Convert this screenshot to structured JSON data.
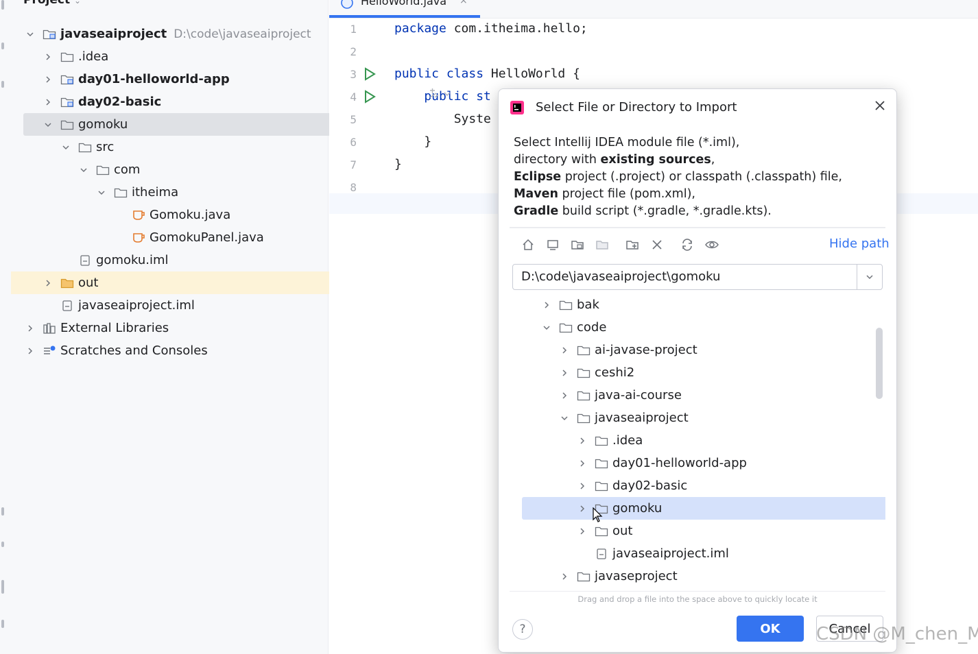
{
  "project_panel": {
    "title": "Project",
    "tree": [
      {
        "label": "javaseaiproject",
        "path": "D:\\code\\javaseaiproject",
        "bold": true,
        "indent": 0,
        "expanded": true,
        "icon": "module-folder-icon"
      },
      {
        "label": ".idea",
        "indent": 1,
        "expanded": false,
        "icon": "folder-icon"
      },
      {
        "label": "day01-helloworld-app",
        "bold": true,
        "indent": 1,
        "expanded": false,
        "icon": "module-folder-icon"
      },
      {
        "label": "day02-basic",
        "bold": true,
        "indent": 1,
        "expanded": false,
        "icon": "module-folder-icon"
      },
      {
        "label": "gomoku",
        "indent": 1,
        "expanded": true,
        "icon": "folder-icon",
        "selected": true
      },
      {
        "label": "src",
        "indent": 2,
        "expanded": true,
        "icon": "folder-icon"
      },
      {
        "label": "com",
        "indent": 3,
        "expanded": true,
        "icon": "folder-icon"
      },
      {
        "label": "itheima",
        "indent": 4,
        "expanded": true,
        "icon": "folder-icon"
      },
      {
        "label": "Gomoku.java",
        "indent": 5,
        "icon": "java-file-icon"
      },
      {
        "label": "GomokuPanel.java",
        "indent": 5,
        "icon": "java-file-icon"
      },
      {
        "label": "gomoku.iml",
        "indent": 2,
        "icon": "iml-file-icon"
      },
      {
        "label": "out",
        "indent": 1,
        "expanded": false,
        "icon": "out-folder-icon",
        "highlight": true
      },
      {
        "label": "javaseaiproject.iml",
        "indent": 1,
        "icon": "iml-file-icon"
      },
      {
        "label": "External Libraries",
        "indent": 0,
        "expanded": false,
        "icon": "libraries-icon"
      },
      {
        "label": "Scratches and Consoles",
        "indent": 0,
        "expanded": false,
        "icon": "scratches-icon"
      }
    ]
  },
  "editor": {
    "tab_label": "HelloWorld.java",
    "lines": [
      {
        "num": "1",
        "parts": [
          {
            "t": "package ",
            "kw": true
          },
          {
            "t": "com.itheima.hello;"
          }
        ]
      },
      {
        "num": "2",
        "parts": []
      },
      {
        "num": "3",
        "parts": [
          {
            "t": "public class ",
            "kw": true
          },
          {
            "t": "HelloWorld {"
          }
        ],
        "run": true
      },
      {
        "num": "4",
        "parts": [
          {
            "t": "    public st",
            "kw": true
          }
        ],
        "run": true
      },
      {
        "num": "5",
        "parts": [
          {
            "t": "        Syste"
          }
        ]
      },
      {
        "num": "6",
        "parts": [
          {
            "t": "    }"
          }
        ]
      },
      {
        "num": "7",
        "parts": [
          {
            "t": "}"
          }
        ]
      },
      {
        "num": "8",
        "parts": []
      }
    ]
  },
  "dialog": {
    "title": "Select File or Directory to Import",
    "description": [
      [
        {
          "t": "Select Intellij IDEA module file (*.iml),"
        }
      ],
      [
        {
          "t": "directory with "
        },
        {
          "t": "existing sources",
          "b": true
        },
        {
          "t": ","
        }
      ],
      [
        {
          "t": "Eclipse",
          "b": true
        },
        {
          "t": " project (.project) or classpath (.classpath) file,"
        }
      ],
      [
        {
          "t": "Maven",
          "b": true
        },
        {
          "t": " project file (pom.xml),"
        }
      ],
      [
        {
          "t": "Gradle",
          "b": true
        },
        {
          "t": " build script (*.gradle, *.gradle.kts)."
        }
      ]
    ],
    "hide_path_label": "Hide path",
    "path_value": "D:\\code\\javaseaiproject\\gomoku",
    "tree": [
      {
        "label": "bak",
        "indent": 0,
        "chev": "right",
        "icon": "folder"
      },
      {
        "label": "code",
        "indent": 0,
        "chev": "down",
        "icon": "folder"
      },
      {
        "label": "ai-javase-project",
        "indent": 1,
        "chev": "right",
        "icon": "folder"
      },
      {
        "label": "ceshi2",
        "indent": 1,
        "chev": "right",
        "icon": "folder"
      },
      {
        "label": "java-ai-course",
        "indent": 1,
        "chev": "right",
        "icon": "folder"
      },
      {
        "label": "javaseaiproject",
        "indent": 1,
        "chev": "down",
        "icon": "folder"
      },
      {
        "label": ".idea",
        "indent": 2,
        "chev": "right",
        "icon": "folder"
      },
      {
        "label": "day01-helloworld-app",
        "indent": 2,
        "chev": "right",
        "icon": "folder"
      },
      {
        "label": "day02-basic",
        "indent": 2,
        "chev": "right",
        "icon": "folder"
      },
      {
        "label": "gomoku",
        "indent": 2,
        "chev": "right",
        "icon": "folder",
        "selected": true
      },
      {
        "label": "out",
        "indent": 2,
        "chev": "right",
        "icon": "folder"
      },
      {
        "label": "javaseaiproject.iml",
        "indent": 2,
        "chev": "none",
        "icon": "file"
      },
      {
        "label": "javaseproject",
        "indent": 1,
        "chev": "right",
        "icon": "folder"
      }
    ],
    "drag_hint": "Drag and drop a file into the space above to quickly locate it",
    "help_label": "?",
    "ok_label": "OK",
    "cancel_label": "Cancel"
  },
  "watermark": "CSDN @M_chen_M",
  "colors": {
    "accent": "#3574f0",
    "keyword": "#0033b3",
    "run_green": "#369650",
    "selection": "#d5e1fb",
    "highlight": "#fdf3d8"
  }
}
